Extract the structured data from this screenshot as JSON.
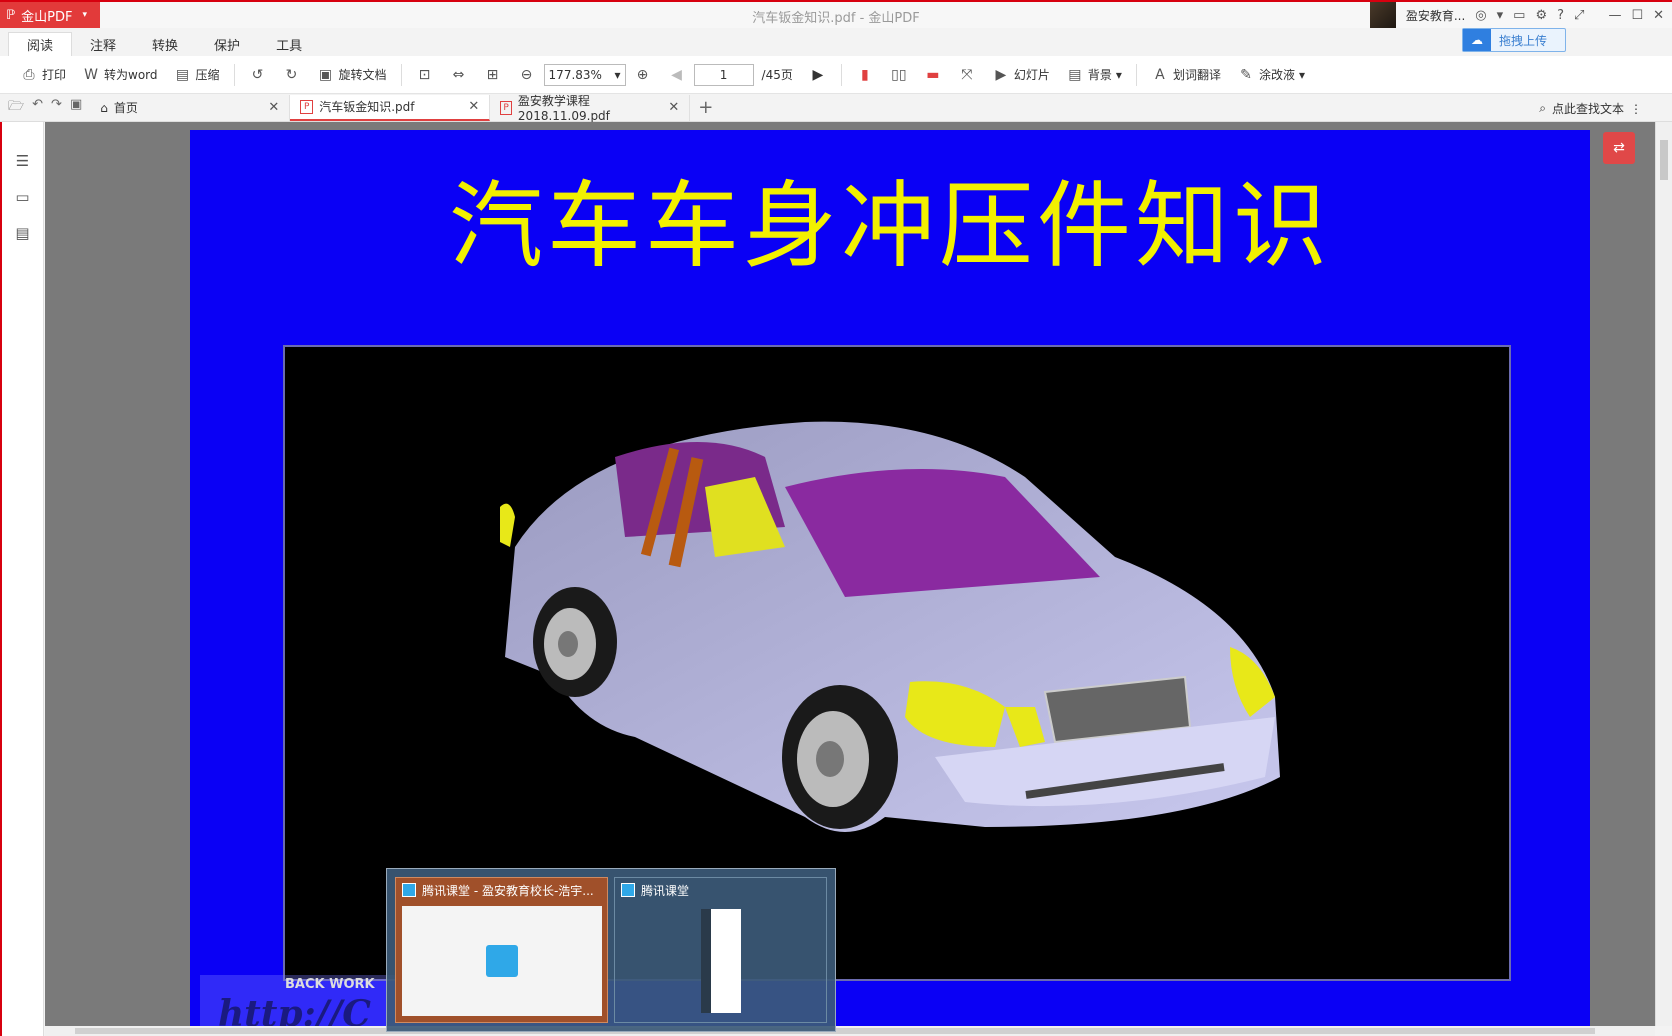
{
  "app": {
    "logo_text": "金山PDF",
    "window_title": "汽车钣金知识.pdf - 金山PDF",
    "username": "盈安教育...",
    "upload_label": "拖拽上传"
  },
  "menu_tabs": [
    "阅读",
    "注释",
    "转换",
    "保护",
    "工具"
  ],
  "toolbar": {
    "print": "打印",
    "to_word": "转为word",
    "compress": "压缩",
    "rotate_doc": "旋转文档",
    "zoom": "177.83%",
    "page_current": "1",
    "page_total": "/45页",
    "slideshow": "幻灯片",
    "background": "背景",
    "translate": "划词翻译",
    "whiteout": "涂改液"
  },
  "doc_tabs": [
    {
      "label": "首页"
    },
    {
      "label": "汽车钣金知识.pdf"
    },
    {
      "label": "盈安教学课程2018.11.09.pdf"
    }
  ],
  "search_label": "点此查找文本",
  "slide": {
    "title": "汽车车身冲压件知识",
    "watermark_top": "BACK WORK",
    "watermark_url": "http://C"
  },
  "taskbar": {
    "preview1_title": "腾讯课堂 - 盈安教育校长-浩宇...",
    "preview2_title": "腾讯课堂"
  },
  "colors": {
    "brand": "#e23a3a",
    "slide_bg": "#0a00f5",
    "title_yellow": "#f2f000"
  }
}
